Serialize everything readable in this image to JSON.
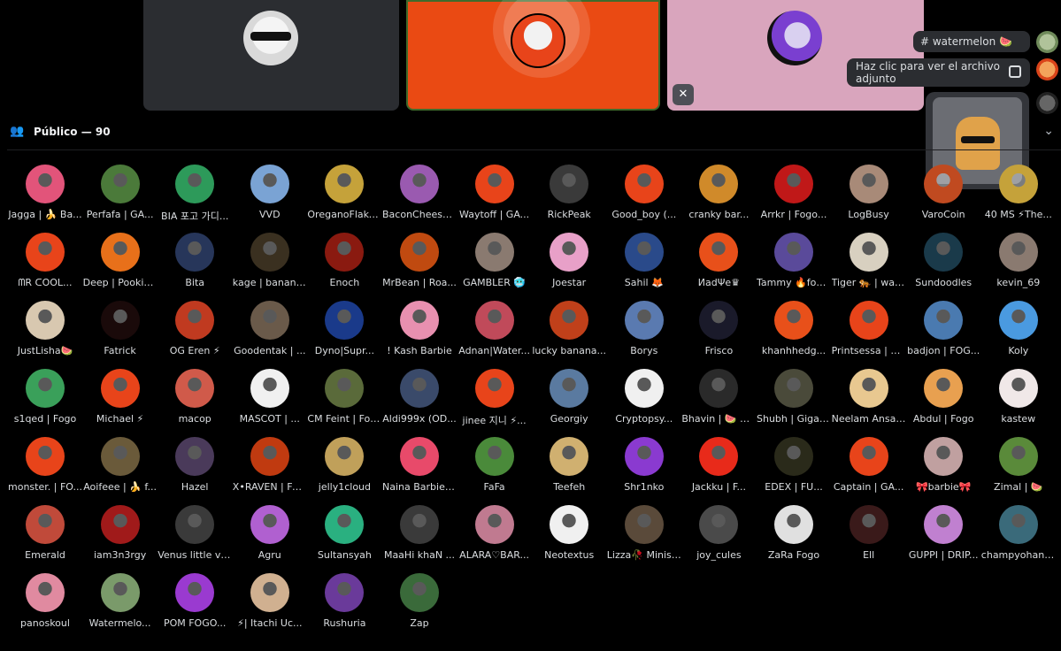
{
  "tiles": [
    {
      "name": "tile-1",
      "color": "#2b2d31"
    },
    {
      "name": "tile-2",
      "color": "#ea4a13",
      "speaking": true
    },
    {
      "name": "tile-3",
      "color": "#d9a5bd",
      "muted": true
    }
  ],
  "popups": {
    "channel": "# watermelon 🍉",
    "attachment": "Haz clic para ver el archivo adjunto"
  },
  "section": {
    "title": "Público — 90"
  },
  "participants": [
    {
      "name": "Jagga | 🍌 Ba...",
      "color": "#e2547a"
    },
    {
      "name": "Perfafa | GA...",
      "color": "#4b7a3a"
    },
    {
      "name": "BIA 포고 가디...",
      "color": "#2d9a5a"
    },
    {
      "name": "VVD",
      "color": "#7aa3d4"
    },
    {
      "name": "OreganoFlake...",
      "color": "#c5a23a"
    },
    {
      "name": "BaconCheese...",
      "color": "#9a5ab0"
    },
    {
      "name": "Waytoff | GA...",
      "color": "#e8441a"
    },
    {
      "name": "RickPeak",
      "color": "#3a3a3a"
    },
    {
      "name": "Good_boy (...",
      "color": "#e8441a"
    },
    {
      "name": "cranky bar...",
      "color": "#d08a2a"
    },
    {
      "name": "Arrkr | Fogo...",
      "color": "#c01818"
    },
    {
      "name": "LogBusy",
      "color": "#a88a78"
    },
    {
      "name": "VaroCoin",
      "color": "#c04a20"
    },
    {
      "name": "40 MS ⚡The...",
      "color": "#c5a23a"
    },
    {
      "name": "ᗰR ᑕOOL...",
      "color": "#e8441a"
    },
    {
      "name": "Deep | Pookie ...",
      "color": "#e8701a"
    },
    {
      "name": "Bita",
      "color": "#27365a"
    },
    {
      "name": "kage | banana...",
      "color": "#3a3020"
    },
    {
      "name": "Enoch",
      "color": "#8a1a10"
    },
    {
      "name": "MrBean | Roa...",
      "color": "#c04a10"
    },
    {
      "name": "GAMBLER 🥶",
      "color": "#8a7a70"
    },
    {
      "name": "Joestar",
      "color": "#e8a0c8"
    },
    {
      "name": "Sahil 🦊",
      "color": "#2a4a8a"
    },
    {
      "name": "ИadΨe♛",
      "color": "#e8501a"
    },
    {
      "name": "Tammy 🔥fog...",
      "color": "#5a4a9a"
    },
    {
      "name": "Tiger 🐅 | wat...",
      "color": "#d8d0c0"
    },
    {
      "name": "Sundoodles",
      "color": "#1a3a4a"
    },
    {
      "name": "kevin_69",
      "color": "#8a7a70"
    },
    {
      "name": "JustLisha🍉",
      "color": "#d8c8b0"
    },
    {
      "name": "Fatrick",
      "color": "#1a0a0a"
    },
    {
      "name": "OG Eren ⚡",
      "color": "#c03a20"
    },
    {
      "name": "Goodentak | ...",
      "color": "#6a5a4a"
    },
    {
      "name": "Dyno|Supr...",
      "color": "#1a3a8a"
    },
    {
      "name": "! Kash Barbie",
      "color": "#e890b0"
    },
    {
      "name": "Adnan|Water...",
      "color": "#c04a5a"
    },
    {
      "name": "lucky banana...",
      "color": "#c0401a"
    },
    {
      "name": "Borys",
      "color": "#5a7ab0"
    },
    {
      "name": "Frisco",
      "color": "#1a1a2a"
    },
    {
      "name": "khanhhedg...",
      "color": "#e8501a"
    },
    {
      "name": "Printsessa | H...",
      "color": "#e8441a"
    },
    {
      "name": "badjon | FOG...",
      "color": "#4a7ab0"
    },
    {
      "name": "Koly",
      "color": "#4a9ae0"
    },
    {
      "name": "s1qed | Fogo",
      "color": "#3aa05a"
    },
    {
      "name": "Michael ⚡",
      "color": "#e8441a"
    },
    {
      "name": "macop",
      "color": "#d05a4a"
    },
    {
      "name": "MASCOT | ...",
      "color": "#f0f0f0"
    },
    {
      "name": "CM Feint | Fogo",
      "color": "#5a6a3a"
    },
    {
      "name": "Aldi999x (OD...",
      "color": "#3a4a6a"
    },
    {
      "name": "jinee 지니 ⚡...",
      "color": "#e8441a"
    },
    {
      "name": "Georgiy",
      "color": "#5a7aa0"
    },
    {
      "name": "Cryptopsy...",
      "color": "#f0f0f0"
    },
    {
      "name": "Bhavin | 🍉 M...",
      "color": "#2a2a2a"
    },
    {
      "name": "Shubh | Giga ...",
      "color": "#4a4a3a"
    },
    {
      "name": "Neelam Ansar...",
      "color": "#e8c890"
    },
    {
      "name": "Abdul | Fogo",
      "color": "#e8a050"
    },
    {
      "name": "kastew",
      "color": "#f0e8e8"
    },
    {
      "name": "monster. | FO...",
      "color": "#e8441a"
    },
    {
      "name": "Aoifeee | 🍌 f...",
      "color": "#6a5a3a"
    },
    {
      "name": "Hazel",
      "color": "#4a3a5a"
    },
    {
      "name": "X•RAVEN | Fur...",
      "color": "#c03a10"
    },
    {
      "name": "jelly1cloud",
      "color": "#c0a05a"
    },
    {
      "name": "Naina Barbie ...",
      "color": "#e84a6a"
    },
    {
      "name": "FaFa",
      "color": "#4a8a3a"
    },
    {
      "name": "Teefeh",
      "color": "#d0b070"
    },
    {
      "name": "Shr1nko",
      "color": "#8a3ad0"
    },
    {
      "name": "Jackku | F...",
      "color": "#e82a1a"
    },
    {
      "name": "EDEX | FU...",
      "color": "#2a2a1a"
    },
    {
      "name": "Captain | GA...",
      "color": "#e8441a"
    },
    {
      "name": "🎀barbie🎀",
      "color": "#c0a0a0"
    },
    {
      "name": "Zimal | 🍉",
      "color": "#5a8a3a"
    },
    {
      "name": "Emerald",
      "color": "#c04a3a"
    },
    {
      "name": "iam3n3rgy",
      "color": "#a01a1a"
    },
    {
      "name": "Venus little va...",
      "color": "#3a3a3a"
    },
    {
      "name": "Agru",
      "color": "#b060d0"
    },
    {
      "name": "Sultansyah",
      "color": "#2ab080"
    },
    {
      "name": "MaaHi khaN ...",
      "color": "#3a3a3a"
    },
    {
      "name": "ALARA♡BAR...",
      "color": "#c07a90"
    },
    {
      "name": "Neotextus",
      "color": "#f0f0f0"
    },
    {
      "name": "Lizza🥀 Minist...",
      "color": "#5a4a3a"
    },
    {
      "name": "joy_cules",
      "color": "#4a4a4a"
    },
    {
      "name": "ZaRa Fogo",
      "color": "#e0e0e0"
    },
    {
      "name": "Ell",
      "color": "#3a1a1a"
    },
    {
      "name": "GUPPI | DRIP...",
      "color": "#c080d0"
    },
    {
      "name": "champyohans...",
      "color": "#3a6a7a"
    },
    {
      "name": "panoskoul",
      "color": "#e08aa0"
    },
    {
      "name": "Watermelo...",
      "color": "#7a9a6a"
    },
    {
      "name": "POM FOGO...",
      "color": "#9a3ad0"
    },
    {
      "name": "⚡| Itachi Uc...",
      "color": "#d0b090"
    },
    {
      "name": "Rushuria",
      "color": "#6a3a9a"
    },
    {
      "name": "Zap",
      "color": "#3a6a3a"
    }
  ]
}
